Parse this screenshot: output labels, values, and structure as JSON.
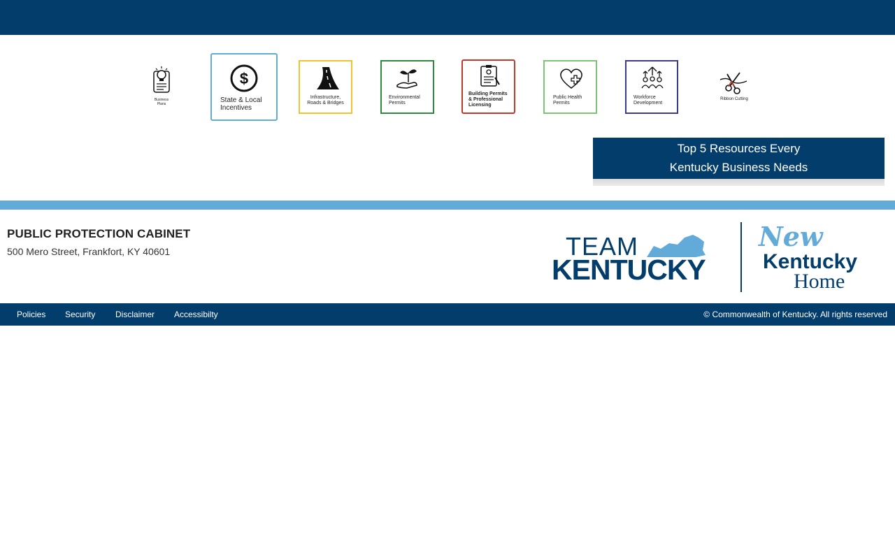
{
  "tiles": [
    {
      "label": "Business Plans",
      "icon": "lightbulb-document-icon",
      "border": ""
    },
    {
      "label": "State & Local Incentives",
      "icon": "dollar-coin-icon",
      "border": "#62aad8"
    },
    {
      "label": "Infrastructure, Roads & Bridges",
      "icon": "road-icon",
      "border": "#f2c230"
    },
    {
      "label": "Environmental Permits",
      "icon": "plant-hand-icon",
      "border": "#2e8b3e"
    },
    {
      "label": "Building Permits & Professional Licensing",
      "icon": "checklist-icon",
      "border": "#c0392b"
    },
    {
      "label": "Public Health Permits",
      "icon": "heart-cross-icon",
      "border": "#7cc576"
    },
    {
      "label": "Workforce Development",
      "icon": "people-arrows-icon",
      "border": "#3c3a8a"
    },
    {
      "label": "Ribbon Cutting",
      "icon": "scissors-ribbon-icon",
      "border": ""
    }
  ],
  "callout": {
    "line1": "Top 5 Resources Every",
    "line2": "Kentucky Business Needs"
  },
  "org": {
    "name": "PUBLIC PROTECTION CABINET",
    "address": "500 Mero Street, Frankfort, KY 40601"
  },
  "brand": {
    "team": "TEAM",
    "kentucky": "KENTUCKY",
    "new": "New",
    "kentucky2": "Kentucky",
    "home": "Home"
  },
  "footer": {
    "links": [
      "Policies",
      "Security",
      "Disclaimer",
      "Accessibilty"
    ],
    "copyright": "© Commonwealth of Kentucky. All rights reserved"
  },
  "colors": {
    "navy": "#033d6b",
    "light_blue": "#62aad8"
  }
}
